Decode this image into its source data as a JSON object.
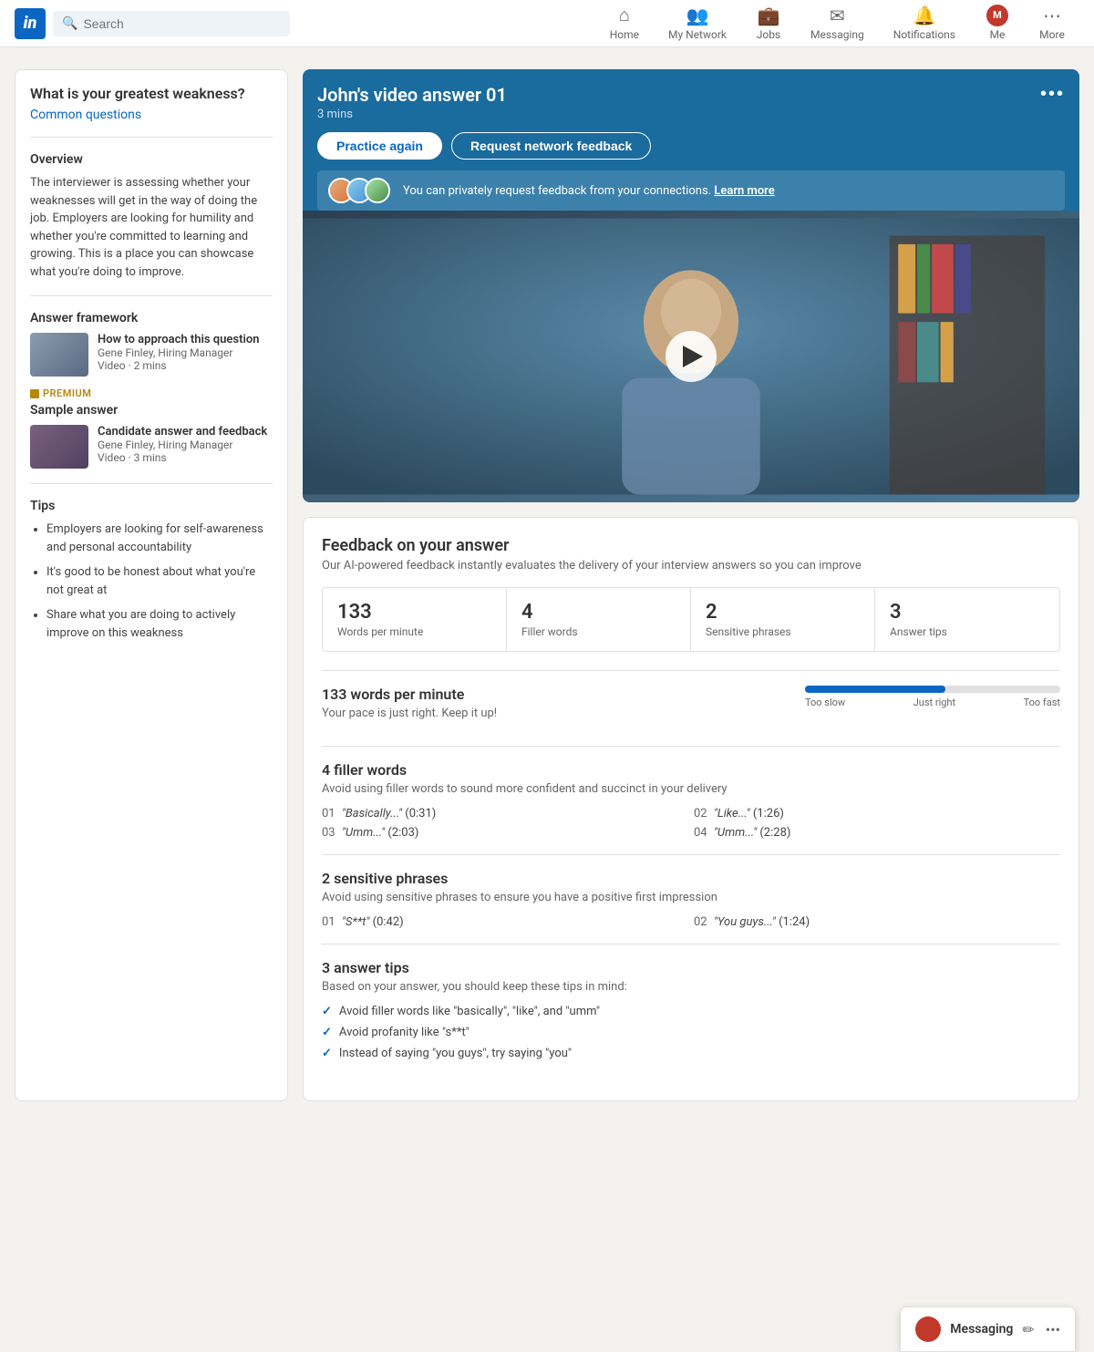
{
  "nav": {
    "logo": "in",
    "search_placeholder": "Search",
    "items": [
      {
        "id": "home",
        "label": "Home",
        "icon": "⌂"
      },
      {
        "id": "network",
        "label": "My Network",
        "icon": "👥"
      },
      {
        "id": "jobs",
        "label": "Jobs",
        "icon": "💼"
      },
      {
        "id": "messaging",
        "label": "Messaging",
        "icon": "✉"
      },
      {
        "id": "notifications",
        "label": "Notifications",
        "icon": "🔔"
      },
      {
        "id": "me",
        "label": "Me",
        "icon": "👤"
      },
      {
        "id": "more",
        "label": "More",
        "icon": "⋯"
      }
    ]
  },
  "sidebar": {
    "question": "What is your greatest weakness?",
    "common_questions_link": "Common questions",
    "overview_title": "Overview",
    "overview_text": "The interviewer is assessing whether your weaknesses will get in the way of doing the job. Employers are looking for humility and whether you're committed to learning and growing. This is a place you can showcase what you're doing to improve.",
    "answer_framework_title": "Answer framework",
    "video1": {
      "title": "How to approach this question",
      "author": "Gene Finley, Hiring Manager",
      "meta": "Video · 2 mins"
    },
    "premium_label": "PREMIUM",
    "sample_answer_title": "Sample answer",
    "video2": {
      "title": "Candidate answer and feedback",
      "author": "Gene Finley, Hiring Manager",
      "meta": "Video · 3 mins"
    },
    "tips_title": "Tips",
    "tips": [
      "Employers are looking for self-awareness and personal accountability",
      "It's good to be honest about what you're not great at",
      "Share what you are doing to actively improve on this weakness"
    ]
  },
  "video_card": {
    "title": "John's video answer 01",
    "duration": "3 mins",
    "more_label": "•••",
    "practice_btn": "Practice again",
    "feedback_btn": "Request network feedback",
    "feedback_text": "You can privately request feedback from your connections.",
    "learn_more": "Learn more"
  },
  "feedback": {
    "title": "Feedback on your answer",
    "subtitle": "Our AI-powered feedback instantly evaluates the delivery of your interview answers so you can improve",
    "stats": [
      {
        "number": "133",
        "label": "Words per minute"
      },
      {
        "number": "4",
        "label": "Filler words"
      },
      {
        "number": "2",
        "label": "Sensitive phrases"
      },
      {
        "number": "3",
        "label": "Answer tips"
      }
    ],
    "wpm": {
      "heading": "133 words per minute",
      "subtext": "Your pace is just right. Keep it up!",
      "bar_fill_pct": 55,
      "labels": [
        "Too slow",
        "Just right",
        "Too fast"
      ]
    },
    "filler": {
      "heading": "4 filler words",
      "subtext": "Avoid using filler words to sound more confident and succinct in your delivery",
      "items": [
        {
          "num": "01",
          "word": "\"Basically...\"",
          "time": "(0:31)"
        },
        {
          "num": "02",
          "word": "\"Like...\"",
          "time": "(1:26)"
        },
        {
          "num": "03",
          "word": "\"Umm...\"",
          "time": "(2:03)"
        },
        {
          "num": "04",
          "word": "\"Umm...\"",
          "time": "(2:28)"
        }
      ]
    },
    "sensitive": {
      "heading": "2 sensitive phrases",
      "subtext": "Avoid using sensitive phrases to ensure you have a positive first impression",
      "items": [
        {
          "num": "01",
          "word": "\"S**t\"",
          "time": "(0:42)"
        },
        {
          "num": "02",
          "word": "\"You guys...\"",
          "time": "(1:24)"
        }
      ]
    },
    "answer_tips": {
      "heading": "3 answer tips",
      "subtext": "Based on your answer, you should keep these tips in mind:",
      "items": [
        "Avoid filler words like \"basically\", \"like\", and \"umm\"",
        "Avoid profanity like \"s**t\"",
        "Instead of saying \"you guys\", try saying \"you\""
      ]
    }
  },
  "messaging": {
    "title": "Messaging",
    "compose_icon": "✏",
    "more_icon": "•••"
  }
}
